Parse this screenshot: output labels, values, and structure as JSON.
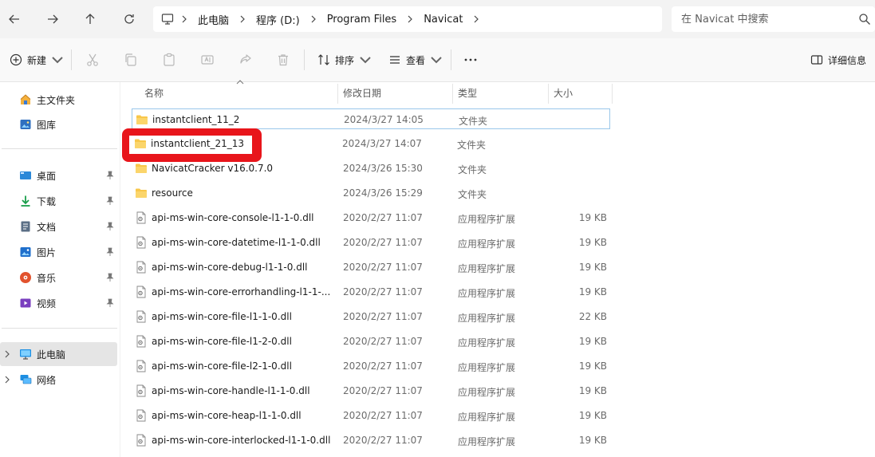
{
  "address": {
    "crumbs": [
      "此电脑",
      "程序 (D:)",
      "Program Files",
      "Navicat"
    ]
  },
  "search": {
    "placeholder": "在 Navicat 中搜索"
  },
  "toolbar": {
    "new_label": "新建",
    "sort_label": "排序",
    "view_label": "查看",
    "details_label": "详细信息"
  },
  "sidebar": {
    "top": [
      {
        "label": "主文件夹",
        "icon": "home-icon"
      },
      {
        "label": "图库",
        "icon": "gallery-icon"
      }
    ],
    "pinned": [
      {
        "label": "桌面",
        "icon": "desktop-icon"
      },
      {
        "label": "下载",
        "icon": "download-icon"
      },
      {
        "label": "文档",
        "icon": "document-icon"
      },
      {
        "label": "图片",
        "icon": "picture-icon"
      },
      {
        "label": "音乐",
        "icon": "music-icon"
      },
      {
        "label": "视频",
        "icon": "video-icon"
      }
    ],
    "bottom": [
      {
        "label": "此电脑",
        "icon": "computer-icon",
        "selected": true
      },
      {
        "label": "网络",
        "icon": "network-icon"
      }
    ]
  },
  "columns": {
    "name": "名称",
    "date": "修改日期",
    "type": "类型",
    "size": "大小"
  },
  "files": [
    {
      "name": "instantclient_11_2",
      "date": "2024/3/27 14:05",
      "type": "文件夹",
      "size": "",
      "kind": "folder"
    },
    {
      "name": "instantclient_21_13",
      "date": "2024/3/27 14:07",
      "type": "文件夹",
      "size": "",
      "kind": "folder"
    },
    {
      "name": "NavicatCracker v16.0.7.0",
      "date": "2024/3/26 15:30",
      "type": "文件夹",
      "size": "",
      "kind": "folder"
    },
    {
      "name": "resource",
      "date": "2024/3/26 15:29",
      "type": "文件夹",
      "size": "",
      "kind": "folder"
    },
    {
      "name": "api-ms-win-core-console-l1-1-0.dll",
      "date": "2020/2/27 11:07",
      "type": "应用程序扩展",
      "size": "19 KB",
      "kind": "dll"
    },
    {
      "name": "api-ms-win-core-datetime-l1-1-0.dll",
      "date": "2020/2/27 11:07",
      "type": "应用程序扩展",
      "size": "19 KB",
      "kind": "dll"
    },
    {
      "name": "api-ms-win-core-debug-l1-1-0.dll",
      "date": "2020/2/27 11:07",
      "type": "应用程序扩展",
      "size": "19 KB",
      "kind": "dll"
    },
    {
      "name": "api-ms-win-core-errorhandling-l1-1-...",
      "date": "2020/2/27 11:07",
      "type": "应用程序扩展",
      "size": "19 KB",
      "kind": "dll"
    },
    {
      "name": "api-ms-win-core-file-l1-1-0.dll",
      "date": "2020/2/27 11:07",
      "type": "应用程序扩展",
      "size": "22 KB",
      "kind": "dll"
    },
    {
      "name": "api-ms-win-core-file-l1-2-0.dll",
      "date": "2020/2/27 11:07",
      "type": "应用程序扩展",
      "size": "19 KB",
      "kind": "dll"
    },
    {
      "name": "api-ms-win-core-file-l2-1-0.dll",
      "date": "2020/2/27 11:07",
      "type": "应用程序扩展",
      "size": "19 KB",
      "kind": "dll"
    },
    {
      "name": "api-ms-win-core-handle-l1-1-0.dll",
      "date": "2020/2/27 11:07",
      "type": "应用程序扩展",
      "size": "19 KB",
      "kind": "dll"
    },
    {
      "name": "api-ms-win-core-heap-l1-1-0.dll",
      "date": "2020/2/27 11:07",
      "type": "应用程序扩展",
      "size": "19 KB",
      "kind": "dll"
    },
    {
      "name": "api-ms-win-core-interlocked-l1-1-0.dll",
      "date": "2020/2/27 11:07",
      "type": "应用程序扩展",
      "size": "19 KB",
      "kind": "dll"
    }
  ],
  "colors": {
    "folder": "#f8c74a",
    "accent": "#0067c0",
    "highlight_border": "#99c7ea",
    "annotation_red": "#e8151b"
  }
}
